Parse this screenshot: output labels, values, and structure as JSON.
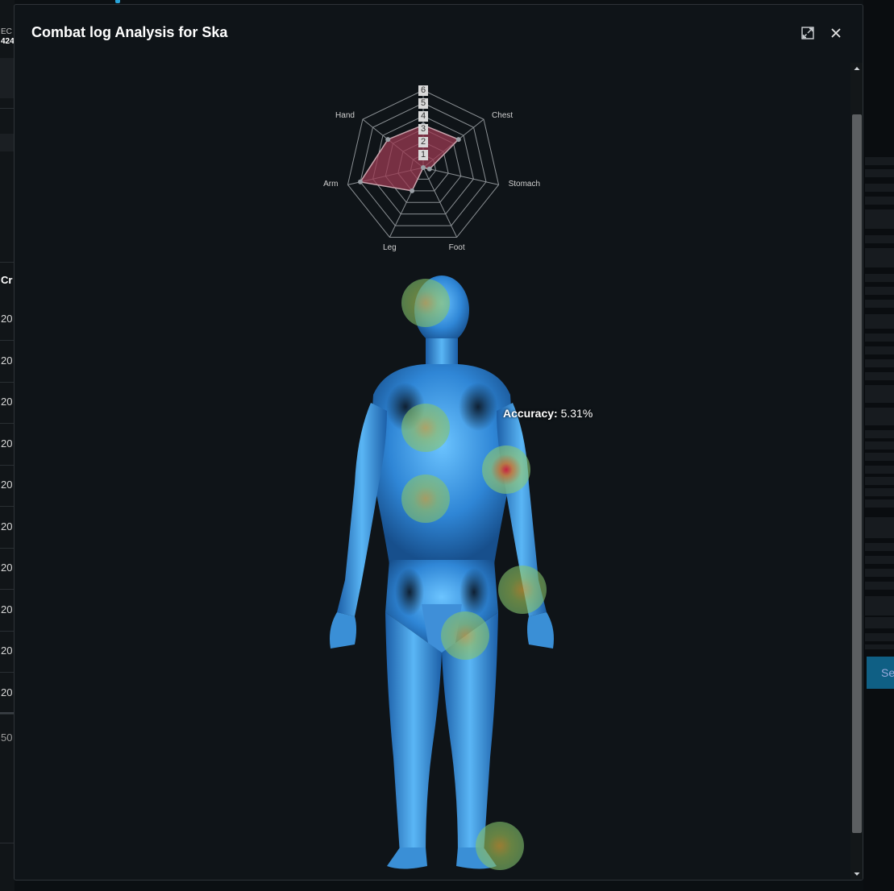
{
  "modal": {
    "title": "Combat log Analysis for Ska",
    "expand_icon": "expand-icon",
    "close_icon": "close-icon"
  },
  "chart_data": {
    "type": "radar",
    "axes": [
      "Chest",
      "Stomach",
      "Foot",
      "Leg",
      "Arm",
      "Hand"
    ],
    "series": [
      {
        "values": [
          3.5,
          0.5,
          0,
          2,
          5,
          3.5
        ]
      }
    ],
    "rlim": [
      0,
      6
    ],
    "ticks": [
      "1",
      "2",
      "3",
      "4",
      "5",
      "6"
    ],
    "fill_color": "#9b3a52",
    "grid": true
  },
  "heatmap": {
    "points": [
      {
        "part": "head"
      },
      {
        "part": "chest"
      },
      {
        "part": "stomach"
      },
      {
        "part": "arm",
        "hot": true
      },
      {
        "part": "hand"
      },
      {
        "part": "leg"
      },
      {
        "part": "foot"
      }
    ]
  },
  "tooltip": {
    "label": "Accuracy:",
    "value": " 5.31%"
  },
  "background": {
    "left_header": "EC",
    "left_sub": "424",
    "left_col": "Cr",
    "left_rows": [
      "20",
      "20",
      "20",
      "20",
      "20",
      "20",
      "20",
      "20",
      "20",
      "20"
    ],
    "left_footer": "50",
    "right_button": "Se"
  }
}
